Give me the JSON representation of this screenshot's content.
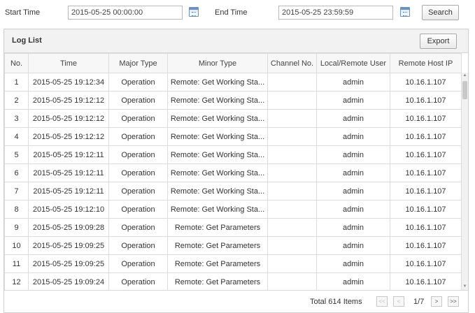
{
  "search": {
    "start_label": "Start Time",
    "start_value": "2015-05-25 00:00:00",
    "end_label": "End Time",
    "end_value": "2015-05-25 23:59:59",
    "search_button": "Search"
  },
  "log_list": {
    "title": "Log List",
    "export_button": "Export",
    "columns": [
      "No.",
      "Time",
      "Major Type",
      "Minor Type",
      "Channel No.",
      "Local/Remote User",
      "Remote Host IP"
    ],
    "rows": [
      [
        "1",
        "2015-05-25 19:12:34",
        "Operation",
        "Remote: Get Working Sta...",
        "",
        "admin",
        "10.16.1.107"
      ],
      [
        "2",
        "2015-05-25 19:12:12",
        "Operation",
        "Remote: Get Working Sta...",
        "",
        "admin",
        "10.16.1.107"
      ],
      [
        "3",
        "2015-05-25 19:12:12",
        "Operation",
        "Remote: Get Working Sta...",
        "",
        "admin",
        "10.16.1.107"
      ],
      [
        "4",
        "2015-05-25 19:12:12",
        "Operation",
        "Remote: Get Working Sta...",
        "",
        "admin",
        "10.16.1.107"
      ],
      [
        "5",
        "2015-05-25 19:12:11",
        "Operation",
        "Remote: Get Working Sta...",
        "",
        "admin",
        "10.16.1.107"
      ],
      [
        "6",
        "2015-05-25 19:12:11",
        "Operation",
        "Remote: Get Working Sta...",
        "",
        "admin",
        "10.16.1.107"
      ],
      [
        "7",
        "2015-05-25 19:12:11",
        "Operation",
        "Remote: Get Working Sta...",
        "",
        "admin",
        "10.16.1.107"
      ],
      [
        "8",
        "2015-05-25 19:12:10",
        "Operation",
        "Remote: Get Working Sta...",
        "",
        "admin",
        "10.16.1.107"
      ],
      [
        "9",
        "2015-05-25 19:09:28",
        "Operation",
        "Remote: Get Parameters",
        "",
        "admin",
        "10.16.1.107"
      ],
      [
        "10",
        "2015-05-25 19:09:25",
        "Operation",
        "Remote: Get Parameters",
        "",
        "admin",
        "10.16.1.107"
      ],
      [
        "11",
        "2015-05-25 19:09:25",
        "Operation",
        "Remote: Get Parameters",
        "",
        "admin",
        "10.16.1.107"
      ],
      [
        "12",
        "2015-05-25 19:09:24",
        "Operation",
        "Remote: Get Parameters",
        "",
        "admin",
        "10.16.1.107"
      ]
    ]
  },
  "pager": {
    "total": "Total 614 Items",
    "page": "1/7",
    "first_icon": "first-page-icon",
    "prev_icon": "prev-page-icon",
    "next_icon": "next-page-icon",
    "last_icon": "last-page-icon"
  },
  "icons": {
    "calendar": "calendar-icon"
  }
}
